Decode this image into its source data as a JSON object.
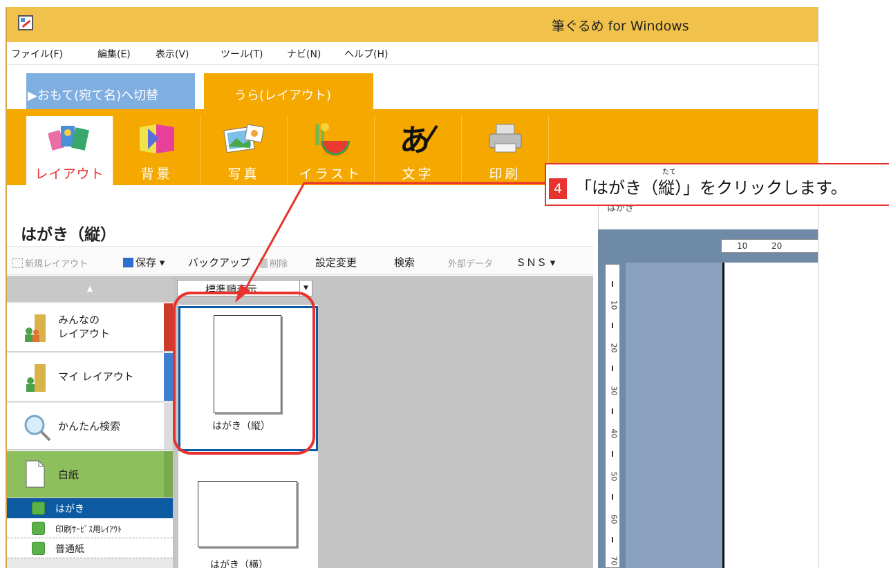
{
  "window": {
    "title": "筆ぐるめ for Windows"
  },
  "menu": [
    "ファイル(F)",
    "編集(E)",
    "表示(V)",
    "ツール(T)",
    "ナビ(N)",
    "ヘルプ(H)"
  ],
  "mode_tabs": {
    "omote": "▶おもて(宛て名)へ切替",
    "ura": "うら(レイアウト)"
  },
  "ribbon": [
    {
      "label": "レイアウト",
      "icon": "layout-cards-icon"
    },
    {
      "label": "背景",
      "icon": "background-icon"
    },
    {
      "label": "写真",
      "icon": "photo-icon"
    },
    {
      "label": "イラスト",
      "icon": "illustration-icon"
    },
    {
      "label": "文字",
      "icon": "text-brush-icon"
    },
    {
      "label": "印刷",
      "icon": "printer-icon"
    }
  ],
  "panel": {
    "title": "はがき（縦）"
  },
  "preview": {
    "heading": "はがき",
    "ruler_h": [
      "10",
      "20"
    ],
    "ruler_v": [
      "10",
      "20",
      "30",
      "40",
      "50",
      "60",
      "70"
    ]
  },
  "toolbar": {
    "new_layout": "新規レイアウト",
    "save": "保存 ▾",
    "backup": "バックアップ",
    "delete": "削除",
    "settings": "設定変更",
    "search": "検索",
    "external": "外部データ",
    "sns": "ＳＮＳ ▾"
  },
  "categories": {
    "scroll_up": "▲",
    "items": [
      {
        "label": "みんなの\nレイアウト",
        "bar_color": "#d03a2a"
      },
      {
        "label": "マイ レイアウト",
        "bar_color": "#3f7fd0"
      },
      {
        "label": "かんたん検索",
        "bar_color": "#dcdcdc"
      },
      {
        "label": "白紙",
        "bar_color": "#7aa950"
      }
    ],
    "sub_items": [
      "はがき",
      "印刷ｻｰﾋﾞｽ用ﾚｲｱｳﾄ",
      "普通紙"
    ]
  },
  "gallery": {
    "sort": "標準順表示",
    "templates": [
      "はがき（縦）",
      "はがき（横）"
    ]
  },
  "callout": {
    "step": "4",
    "text": "「はがき（縦）」をクリックします。",
    "ruby": "たて"
  },
  "colors": {
    "accent_orange": "#f5a800",
    "title_yellow": "#f1c24b",
    "highlight_red": "#e8322e",
    "select_blue": "#0b5aa2"
  }
}
